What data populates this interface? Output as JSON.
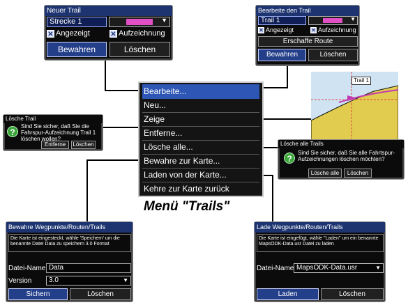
{
  "new_trail": {
    "title": "Neuer Trail",
    "name_value": "Strecke 1",
    "shown_label": "Angezeigt",
    "recording_label": "Aufzeichnung",
    "save_button": "Bewahren",
    "delete_button": "Löschen",
    "color": "#e04fc3"
  },
  "edit_trail": {
    "title": "Bearbeite den Trail",
    "name_value": "Trail 1",
    "shown_label": "Angezeigt",
    "recording_label": "Aufzeichnung",
    "create_route_button": "Erschaffe Route",
    "save_button": "Bewahren",
    "delete_button": "Löschen"
  },
  "map_preview": {
    "trail_label": "Trail 1"
  },
  "delete_trail": {
    "title": "Lösche Trail",
    "message": "Sind Sie sicher, daß Sie die Fahrspur-Aufzeichnung Trail 1 löschen wollen?",
    "remove_button": "Entferne",
    "delete_button": "Löschen"
  },
  "delete_all": {
    "title": "Lösche alle Trails",
    "message": "Sind Sie sicher, daß Sie alle Fahrtspur-Aufzeichnungen löschen möchten?",
    "delete_all_button": "Lösche alle",
    "delete_button": "Löschen"
  },
  "menu": {
    "items": [
      "Bearbeite...",
      "Neu...",
      "Zeige",
      "Entferne...",
      "Lösche alle...",
      "Bewahre zur Karte...",
      "Laden von der Karte...",
      "Kehre zur Karte zurück"
    ],
    "caption": "Menü \"Trails\""
  },
  "save_dialog": {
    "title": "Bewahre Wegpunkte/Routen/Trails",
    "info": "Die Karte ist eingesteckt, wähle 'Speichern' um die benannte Datei Data zu speichern 3.0 Format",
    "filename_label": "Datei-Name",
    "filename_value": "Data",
    "version_label": "Version",
    "version_value": "3.0",
    "save_button": "Sichern",
    "delete_button": "Löschen"
  },
  "load_dialog": {
    "title": "Lade Wegpunkte/Routen/Trails",
    "info": "Die Karte ist eingefügt, wähle \"Laden\" um ein benannte MapsODK-Data.usr Datei zu laden",
    "filename_label": "Datei-Name",
    "filename_value": "MapsODK-Data.usr",
    "load_button": "Laden",
    "delete_button": "Löschen"
  }
}
